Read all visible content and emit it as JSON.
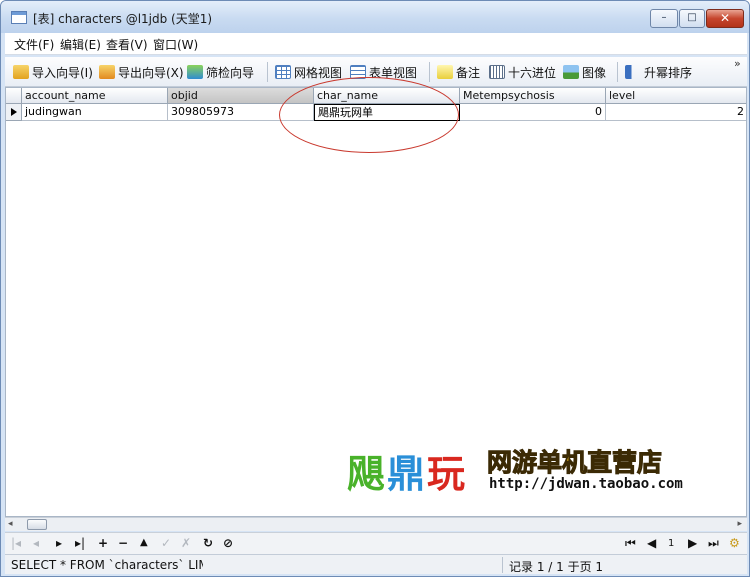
{
  "window": {
    "title": "[表] characters @l1jdb (天堂1)",
    "controls": {
      "minimize": "–",
      "maximize": "□",
      "close": "✕"
    }
  },
  "menu": [
    "文件(F)",
    "编辑(E)",
    "查看(V)",
    "窗口(W)"
  ],
  "toolbar": {
    "import_wizard": "导入向导(I)",
    "export_wizard": "导出向导(X)",
    "filter_wizard": "筛检向导",
    "grid_view": "网格视图",
    "form_view": "表单视图",
    "memo": "备注",
    "hex": "十六进位",
    "image": "图像",
    "sort_asc": "升幂排序",
    "overflow": "»"
  },
  "grid": {
    "columns": [
      "account_name",
      "objid",
      "char_name",
      "Metempsychosis",
      "level"
    ],
    "rows": [
      [
        "judingwan",
        "309805973",
        "飓鼎玩网单",
        "0",
        "2"
      ]
    ]
  },
  "watermark": {
    "brand_1": "飓",
    "brand_2": "鼎",
    "brand_3": "玩",
    "slogan": "网游单机直营店",
    "url": "http://jdwan.taobao.com"
  },
  "navbar": {
    "first": "|◂",
    "prev": "◂",
    "next": "▸",
    "last": "▸|",
    "add": "+",
    "delete": "−",
    "up": "▲",
    "apply": "✓",
    "discard": "✗",
    "refresh": "↻",
    "stop": "⊘",
    "page_first": "⏮",
    "page_prev": "◀",
    "page_number": "1",
    "page_next": "▶",
    "page_last": "⏭",
    "settings": "⚙"
  },
  "status": {
    "sql": "SELECT * FROM `characters` LIMI",
    "record": "记录 1 / 1 于页 1"
  },
  "colors": {
    "annotation": "#c9392e",
    "brand_green": "#49b22a",
    "brand_blue": "#2a8fd8",
    "brand_red": "#d9281f",
    "slogan_yellow": "#f4c21c"
  }
}
